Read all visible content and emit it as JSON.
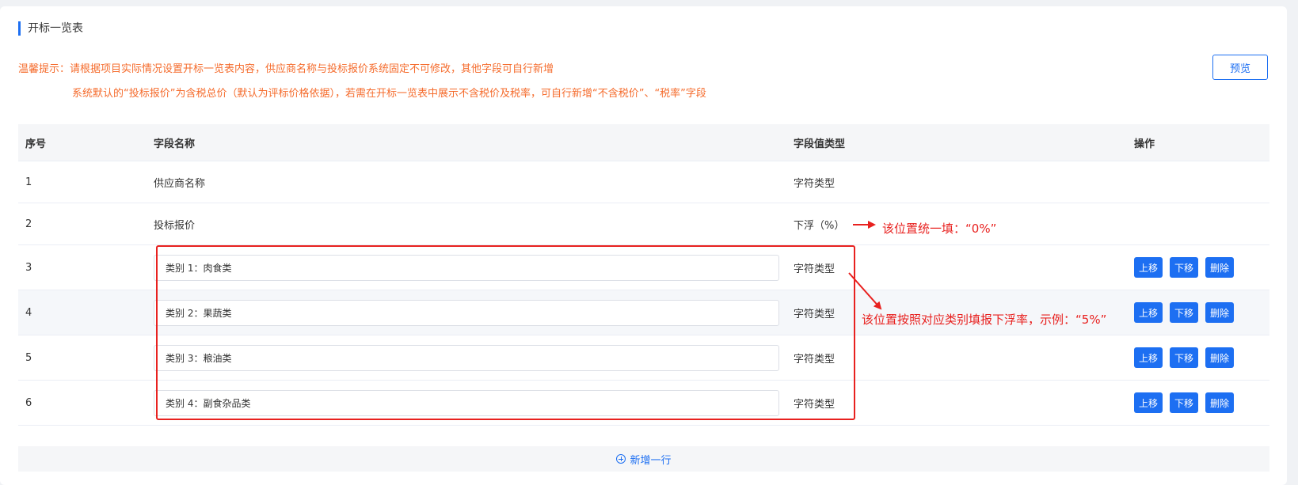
{
  "section_title": "开标一览表",
  "tips": {
    "line1": "温馨提示：请根据项目实际情况设置开标一览表内容，供应商名称与投标报价系统固定不可修改，其他字段可自行新增",
    "line2": "系统默认的“投标报价”为含税总价（默认为评标价格依据），若需在开标一览表中展示不含税价及税率，可自行新增“不含税价”、“税率”字段"
  },
  "preview_button": "预览",
  "table": {
    "headers": {
      "index": "序号",
      "name": "字段名称",
      "type": "字段值类型",
      "ops": "操作"
    },
    "rows": [
      {
        "index": "1",
        "name": "供应商名称",
        "type": "字符类型"
      },
      {
        "index": "2",
        "name": "投标报价",
        "type": "下浮（%）"
      },
      {
        "index": "3",
        "name": "类别 1：肉食类",
        "type": "字符类型"
      },
      {
        "index": "4",
        "name": "类别 2：果蔬类",
        "type": "字符类型"
      },
      {
        "index": "5",
        "name": "类别 3：粮油类",
        "type": "字符类型"
      },
      {
        "index": "6",
        "name": "类别 4：副食杂品类",
        "type": "字符类型"
      }
    ],
    "ops": {
      "up": "上移",
      "down": "下移",
      "delete": "删除"
    }
  },
  "add_row_label": "新增一行",
  "annotations": {
    "note1": "该位置统一填：“0%”",
    "note2": "该位置按照对应类别填报下浮率，示例：“5%”"
  },
  "colors": {
    "accent": "#1d6ff2",
    "tip": "#f56c2d",
    "annotation": "#e8211f"
  }
}
